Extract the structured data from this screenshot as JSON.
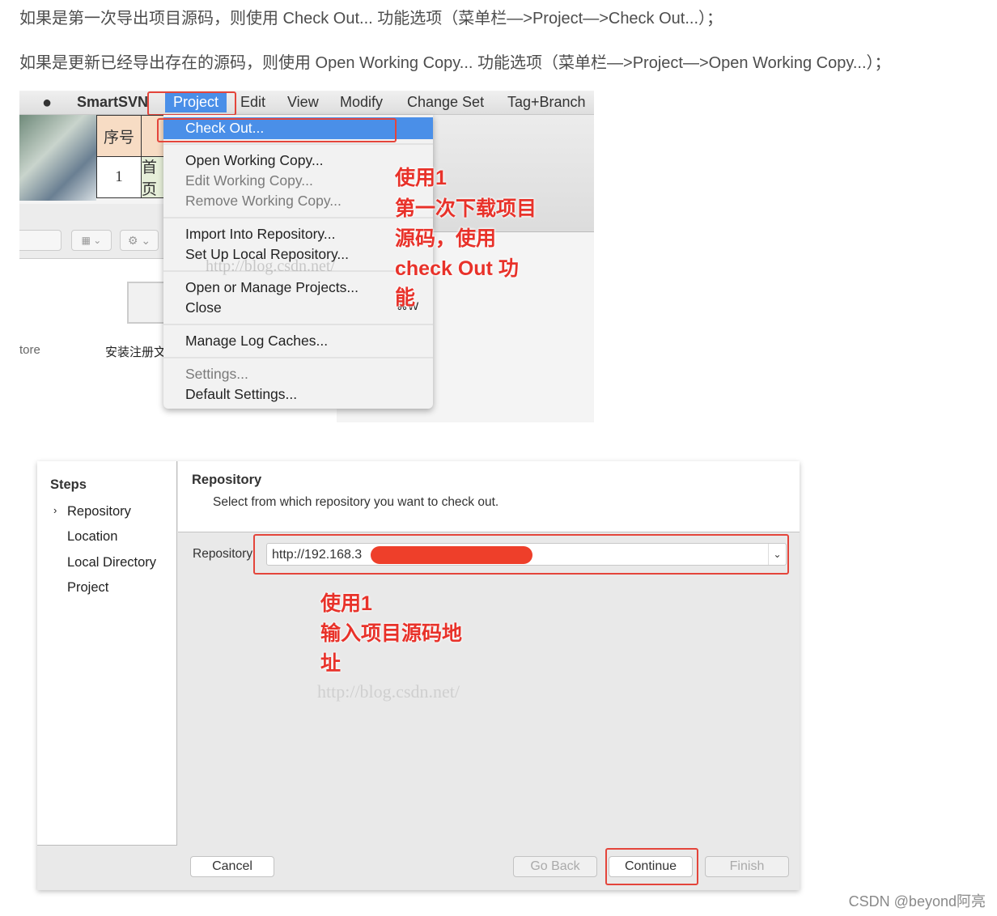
{
  "article": {
    "line1": "如果是第一次导出项目源码，则使用 Check Out... 功能选项（菜单栏—>Project—>Check Out...）；",
    "line2": "如果是更新已经导出存在的源码，则使用 Open Working Copy... 功能选项（菜单栏—>Project—>Open Working Copy...）；"
  },
  "screenshot1": {
    "menubar": {
      "app": "SmartSVN",
      "items": [
        "Project",
        "Edit",
        "View",
        "Modify",
        "Change Set",
        "Tag+Branch"
      ]
    },
    "table": {
      "header": "序号",
      "row_num": "1",
      "row_text": "首页"
    },
    "desktop": {
      "label_left": "tore",
      "label_mid": "安装注册文"
    },
    "dropdown": {
      "items": [
        {
          "label": "Check Out...",
          "state": "highlighted"
        },
        {
          "label": "Open Working Copy...",
          "state": "enabled"
        },
        {
          "label": "Edit Working Copy...",
          "state": "disabled"
        },
        {
          "label": "Remove Working Copy...",
          "state": "disabled"
        },
        {
          "label": "Import Into Repository...",
          "state": "enabled"
        },
        {
          "label": "Set Up Local Repository...",
          "state": "enabled"
        },
        {
          "label": "Open or Manage Projects...",
          "state": "enabled"
        },
        {
          "label": "Close",
          "state": "enabled",
          "shortcut": "⌘W"
        },
        {
          "label": "Manage Log Caches...",
          "state": "enabled"
        },
        {
          "label": "Settings...",
          "state": "disabled"
        },
        {
          "label": "Default Settings...",
          "state": "enabled"
        }
      ]
    },
    "annotation": [
      "使用1",
      "第一次下载项目",
      "源码，使用",
      "check Out 功",
      "能"
    ],
    "watermark": "http://blog.csdn.net/"
  },
  "screenshot2": {
    "steps_title": "Steps",
    "steps": [
      {
        "label": "Repository",
        "current": true
      },
      {
        "label": "Location"
      },
      {
        "label": "Local Directory"
      },
      {
        "label": "Project"
      }
    ],
    "header_title": "Repository",
    "header_desc": "Select from which repository you want to check out.",
    "repo_label": "Repository:",
    "repo_value": "http://192.168.3",
    "annotation": [
      "使用1",
      "输入项目源码地",
      "址"
    ],
    "watermark": "http://blog.csdn.net/",
    "buttons": {
      "cancel": "Cancel",
      "back": "Go Back",
      "continue": "Continue",
      "finish": "Finish"
    }
  },
  "footer_watermark": "CSDN @beyond阿亮",
  "colors": {
    "highlight": "#4a8fe8",
    "annotation": "#e8322a",
    "redaction": "#ee3f2a"
  }
}
